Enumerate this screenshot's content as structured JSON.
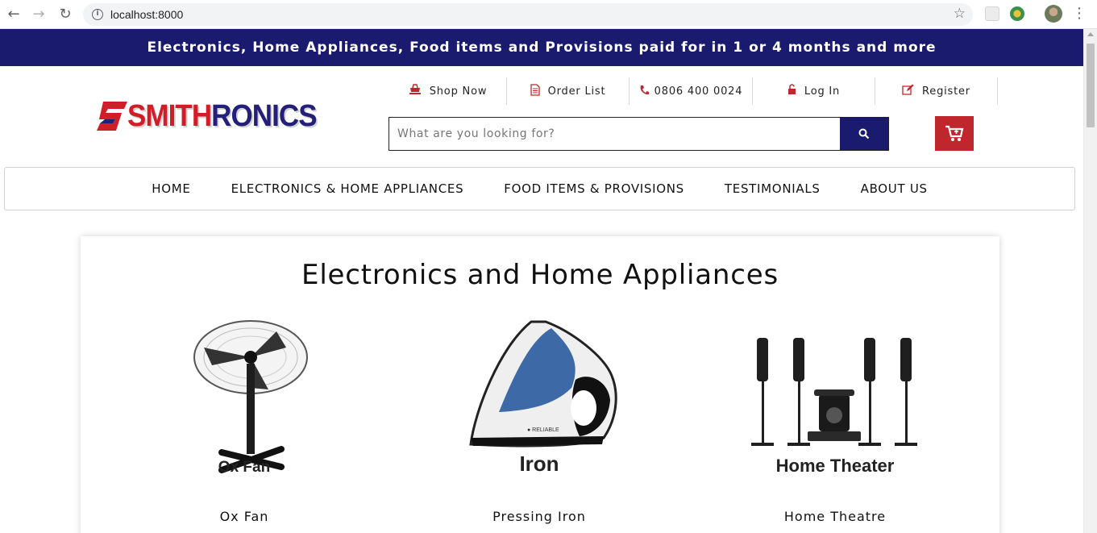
{
  "browser": {
    "url": "localhost:8000"
  },
  "promo": {
    "text": "Electronics, Home Appliances, Food items and Provisions paid for in 1 or 4 months and more"
  },
  "brand": {
    "part1": "SMITH",
    "part2": "RONICS"
  },
  "toplinks": [
    {
      "label": "Shop Now",
      "icon": "shop-icon"
    },
    {
      "label": "Order List",
      "icon": "document-icon"
    },
    {
      "label": "0806 400 0024",
      "icon": "phone-icon"
    },
    {
      "label": "Log In",
      "icon": "lock-icon"
    },
    {
      "label": "Register",
      "icon": "edit-icon"
    }
  ],
  "search": {
    "placeholder": "What are you looking for?"
  },
  "nav": [
    {
      "label": "HOME"
    },
    {
      "label": "ELECTRONICS & HOME APPLIANCES"
    },
    {
      "label": "FOOD ITEMS & PROVISIONS"
    },
    {
      "label": "TESTIMONIALS"
    },
    {
      "label": "ABOUT US"
    }
  ],
  "section": {
    "title": "Electronics and Home Appliances"
  },
  "products": [
    {
      "name": "Ox Fan",
      "image_caption": "Ox Fan"
    },
    {
      "name": "Pressing Iron",
      "image_caption": "Iron"
    },
    {
      "name": "Home Theatre",
      "image_caption": "Home Theater"
    }
  ],
  "colors": {
    "navy": "#1a1a6e",
    "red": "#c0272d"
  }
}
